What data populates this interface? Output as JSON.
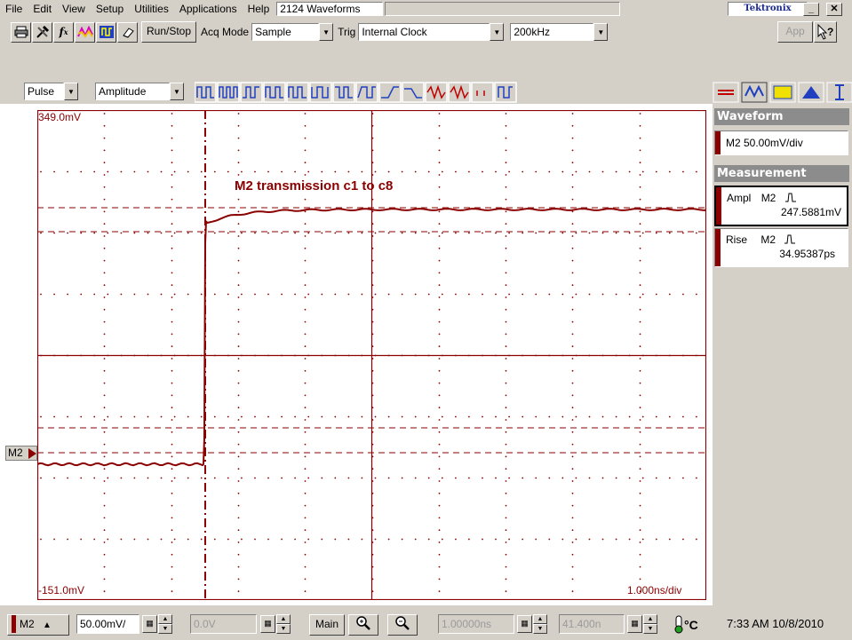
{
  "menu": {
    "items": [
      "File",
      "Edit",
      "View",
      "Setup",
      "Utilities",
      "Applications",
      "Help"
    ],
    "status_text": "2124 Waveforms",
    "brand": "Tektronix"
  },
  "toolbar": {
    "run_stop": "Run/Stop",
    "acq_mode_label": "Acq Mode",
    "acq_mode_value": "Sample",
    "trig_label": "Trig",
    "trig_value": "Internal Clock",
    "rate_value": "200kHz",
    "app_label": "App"
  },
  "meas_toolbar": {
    "category": "Pulse",
    "measurement": "Amplitude"
  },
  "plot": {
    "top_label": "349.0mV",
    "bottom_label": "-151.0mV",
    "timebase_label": "1.000ns/div",
    "title": "M2 transmission c1 to c8",
    "channel_marker": "M2",
    "colors": {
      "trace": "#8b0000",
      "grid": "#8b0000",
      "background": "#ffffff"
    }
  },
  "side_panel": {
    "waveform_header": "Waveform",
    "waveform_item": "M2 50.00mV/div",
    "measurement_header": "Measurement",
    "measurements": [
      {
        "name": "Ampl",
        "source": "M2",
        "value": "247.5881mV"
      },
      {
        "name": "Rise",
        "source": "M2",
        "value": "34.95387ps"
      }
    ]
  },
  "status": {
    "channel": "M2",
    "scale": "50.00mV/",
    "offset": "0.0V",
    "timebase_mode": "Main",
    "position": "1.00000ns",
    "delay": "41.400n",
    "datetime": "7:33 AM 10/8/2010"
  }
}
